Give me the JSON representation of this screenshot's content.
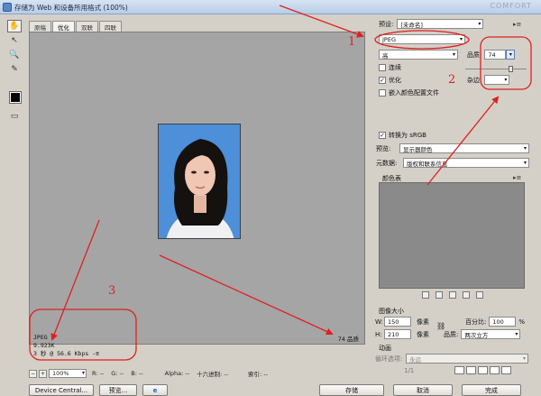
{
  "window": {
    "title": "存储为 Web 和设备所用格式 (100%)",
    "watermark": "COMFORT"
  },
  "tabs": [
    "原稿",
    "优化",
    "双联",
    "四联"
  ],
  "status_left": [
    "JPEG",
    "9.923K",
    "3 秒 @ 56.6 Kbps"
  ],
  "status_left_menu": "-≡",
  "status_right": "74 品质",
  "info_bar": {
    "zoom_minus": "−",
    "zoom_plus": "+",
    "zoom": "100%",
    "r": "R: --",
    "g": "G: --",
    "b": "B: --",
    "alpha": "Alpha: --",
    "hex": "十六进制: --",
    "index": "索引: --"
  },
  "bottom_buttons": {
    "device_central": "Device Central...",
    "preview": "预览...",
    "browser_icon": "e",
    "save": "存储",
    "cancel": "取消",
    "done": "完成"
  },
  "panel": {
    "preset_label": "预设:",
    "preset_value": "[未命名]",
    "format": "JPEG",
    "quality_level": "高",
    "quality_label": "品质:",
    "quality_value": "74",
    "progressive": "连续",
    "optimized": "优化",
    "blur_label": "杂边:",
    "embed_profile": "嵌入颜色配置文件",
    "convert_srgb": "转换为 sRGB",
    "preview_label": "预览:",
    "preview_value": "显示器颜色",
    "metadata_label": "元数据:",
    "metadata_value": "版权和联系信息",
    "color_table": "颜色表",
    "image_size": "图像大小",
    "w_label": "W:",
    "w_value": "150",
    "h_label": "H:",
    "h_value": "210",
    "px": "像素",
    "percent_label": "百分比:",
    "percent_value": "100",
    "percent_unit": "%",
    "quality2_label": "品质:",
    "quality2_value": "两次立方",
    "animation": "动画",
    "loop_label": "循环选项:",
    "loop_value": "永远",
    "frame_counter": "1/1",
    "menu_icon": "▸≡"
  },
  "annotations": {
    "one": "1",
    "two": "2",
    "three": "3"
  },
  "colors": {
    "arrow": "#e02020",
    "photo_bg": "#4d8fd9",
    "canvas": "#a5a5a5"
  }
}
